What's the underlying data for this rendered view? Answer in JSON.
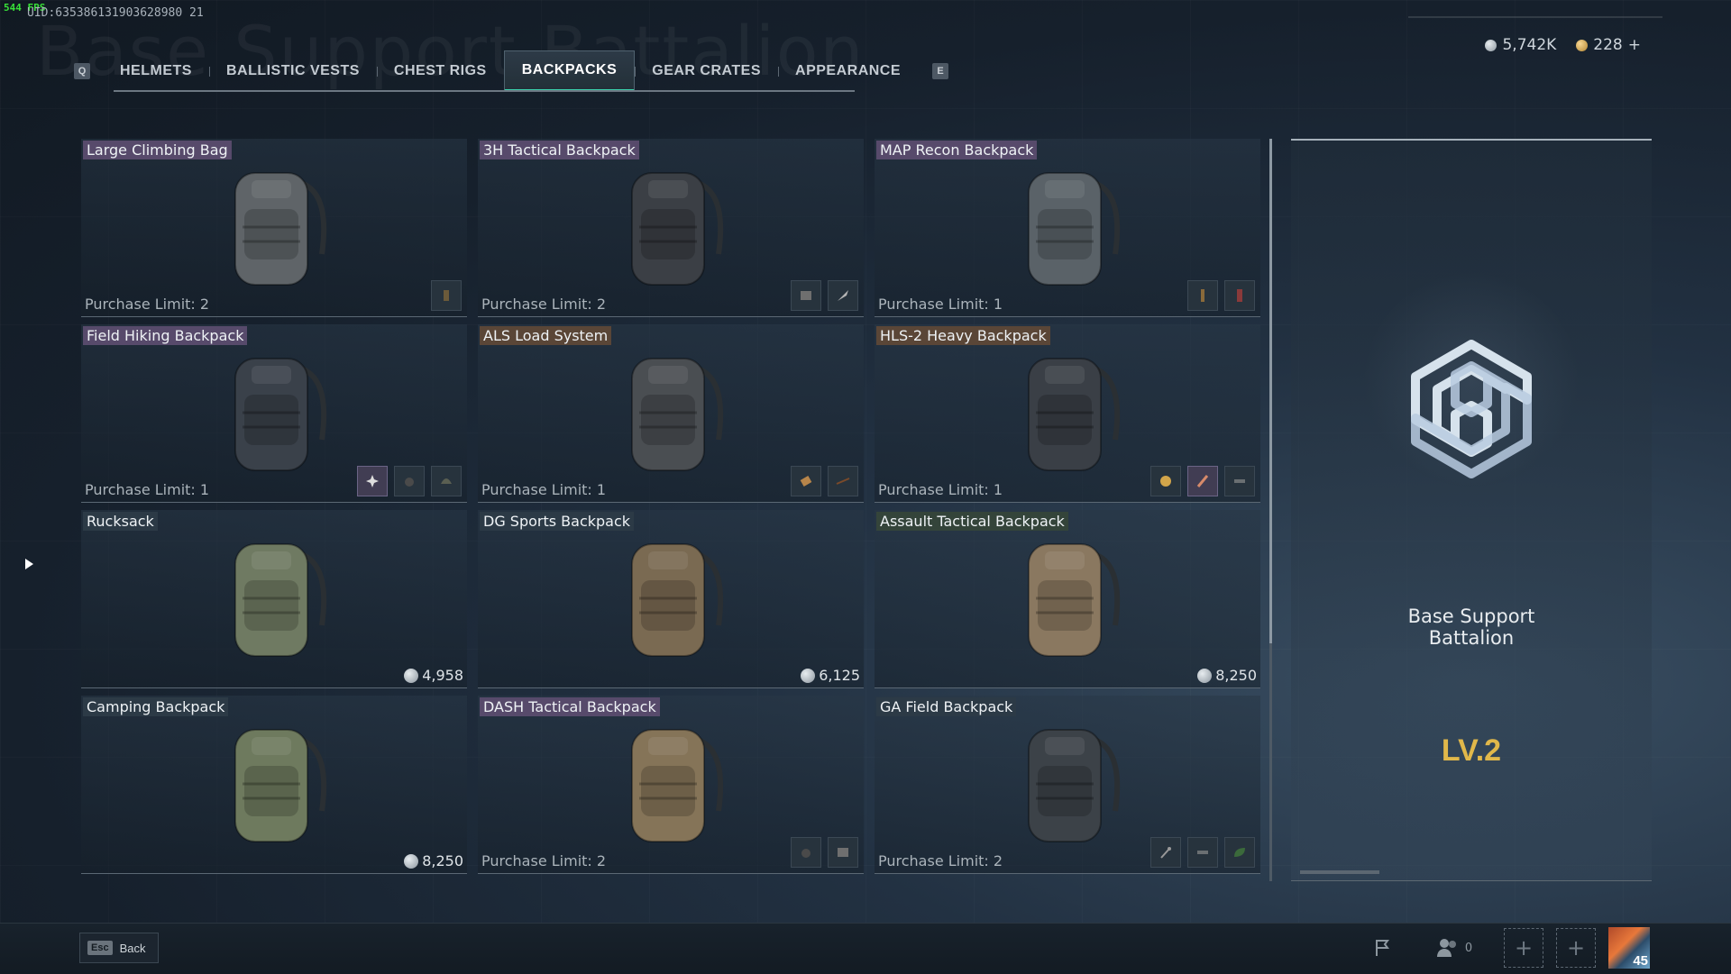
{
  "debug": {
    "fps": "544 FPS",
    "uid": "UID:635386131903628980 21"
  },
  "background_title": "Base Support Battalion",
  "tabs": {
    "prev_key": "Q",
    "next_key": "E",
    "items": [
      {
        "label": "HELMETS"
      },
      {
        "label": "BALLISTIC VESTS"
      },
      {
        "label": "CHEST RIGS"
      },
      {
        "label": "BACKPACKS",
        "active": true
      },
      {
        "label": "GEAR CRATES"
      },
      {
        "label": "APPEARANCE"
      }
    ]
  },
  "currency": {
    "silver": "5,742K",
    "gold": "228",
    "add": "+"
  },
  "items": [
    {
      "name": "Large Climbing Bag",
      "limit": "Purchase Limit: 2",
      "rarity": "purple",
      "icons": [
        "ammo-icon"
      ],
      "color": "#5f6468"
    },
    {
      "name": "3H Tactical Backpack",
      "limit": "Purchase Limit: 2",
      "rarity": "purple",
      "icons": [
        "card-icon",
        "knife-icon"
      ],
      "color": "#3b3f45"
    },
    {
      "name": "MAP Recon Backpack",
      "limit": "Purchase Limit: 1",
      "rarity": "purple",
      "icons": [
        "tube-icon",
        "phone-icon"
      ],
      "color": "#5a6268"
    },
    {
      "name": "Field Hiking Backpack",
      "limit": "Purchase Limit: 1",
      "rarity": "purple",
      "icons": [
        "spark-icon",
        "grenade-icon",
        "helmet-icon"
      ],
      "color": "#3a414a"
    },
    {
      "name": "ALS Load System",
      "limit": "Purchase Limit: 1",
      "rarity": "brown",
      "icons": [
        "bandage-icon",
        "rifle-icon"
      ],
      "color": "#4a4e52"
    },
    {
      "name": "HLS-2 Heavy Backpack",
      "limit": "Purchase Limit: 1",
      "rarity": "brown",
      "icons": [
        "trophy-icon",
        "stick-icon",
        "bar-icon"
      ],
      "color": "#3a3f46"
    },
    {
      "name": "Rucksack",
      "price": "4,958",
      "rarity": "none",
      "color": "#6f7a62"
    },
    {
      "name": "DG Sports Backpack",
      "price": "6,125",
      "rarity": "none",
      "color": "#7a6a52"
    },
    {
      "name": "Assault Tactical Backpack",
      "price": "8,250",
      "rarity": "green",
      "color": "#8a7860"
    },
    {
      "name": "Camping Backpack",
      "price": "8,250",
      "rarity": "none",
      "color": "#6e7a5e"
    },
    {
      "name": "DASH Tactical Backpack",
      "limit": "Purchase Limit: 2",
      "rarity": "purple",
      "icons": [
        "grenade-icon",
        "card-icon"
      ],
      "color": "#857458"
    },
    {
      "name": "GA Field Backpack",
      "limit": "Purchase Limit: 2",
      "rarity": "none",
      "icons": [
        "wrench-icon",
        "bar-icon",
        "leaf-icon"
      ],
      "color": "#3c4248"
    }
  ],
  "detail": {
    "title_line1": "Base Support",
    "title_line2": "Battalion",
    "level": "LV.2"
  },
  "bottom": {
    "esc_key": "Esc",
    "back_label": "Back",
    "squad_count": "0",
    "player_level": "45"
  }
}
